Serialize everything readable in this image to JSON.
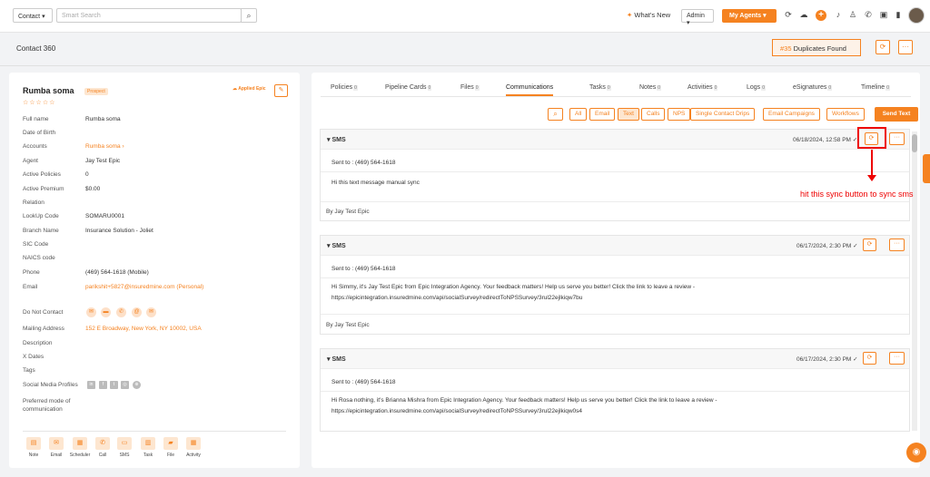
{
  "topbar": {
    "module_select": "Contact",
    "search_placeholder": "Smart Search",
    "whats_new": "What's New",
    "admin": "Admin",
    "my_agents": "My Agents"
  },
  "header": {
    "title": "Contact 360",
    "duplicates_count": "#35",
    "duplicates_label": "Duplicates Found"
  },
  "contact": {
    "name": "Rumba soma",
    "badge": "Prospect",
    "applied_epic": "Applied Epic",
    "fields": [
      {
        "label": "Full name",
        "value": "Rumba soma"
      },
      {
        "label": "Date of Birth",
        "value": ""
      },
      {
        "label": "Accounts",
        "value": "Rumba soma ›",
        "link": true
      },
      {
        "label": "Agent",
        "value": "Jay Test Epic"
      },
      {
        "label": "Active Policies",
        "value": "0"
      },
      {
        "label": "Active Premium",
        "value": "$0.00"
      },
      {
        "label": "Relation",
        "value": ""
      },
      {
        "label": "LookUp Code",
        "value": "SOMARU0001"
      },
      {
        "label": "Branch Name",
        "value": "Insurance Solution - Joliet"
      },
      {
        "label": "SIC Code",
        "value": ""
      },
      {
        "label": "NAICS code",
        "value": ""
      },
      {
        "label": "Phone",
        "value": "(469) 564-1618 (Mobile)"
      },
      {
        "label": "Email",
        "value": "parikshit+5827@insuredmine.com  (Personal)",
        "link": true
      }
    ],
    "do_not_contact": "Do Not Contact",
    "mailing_label": "Mailing Address",
    "mailing_value": "152 E Broadway, New York, NY 10002, USA",
    "description": "Description",
    "x_dates": "X Dates",
    "tags": "Tags",
    "social": "Social Media Profiles",
    "preferred_1": "Preferred mode of",
    "preferred_2": "communication",
    "actions": [
      "Note",
      "Email",
      "Scheduler",
      "Call",
      "SMS",
      "Task",
      "File",
      "Activity"
    ]
  },
  "tabs": [
    {
      "label": "Policies",
      "count": "0"
    },
    {
      "label": "Pipeline Cards",
      "count": "0"
    },
    {
      "label": "Files",
      "count": "0"
    },
    {
      "label": "Communications",
      "count": ""
    },
    {
      "label": "Tasks",
      "count": "0"
    },
    {
      "label": "Notes",
      "count": "0"
    },
    {
      "label": "Activities",
      "count": "0"
    },
    {
      "label": "Logs",
      "count": "0"
    },
    {
      "label": "eSignatures",
      "count": "0"
    },
    {
      "label": "Timeline",
      "count": "0"
    }
  ],
  "filters": [
    "All",
    "Email",
    "Text",
    "Calls",
    "NPS",
    "Single Contact Drips",
    "Email Campaigns",
    "Workflows"
  ],
  "send_text": "Send Text",
  "messages": [
    {
      "type": "SMS",
      "date": "06/18/2024, 12:58 PM",
      "sent_to": "Sent to : (469) 564-1618",
      "body": "Hi this text message manual sync",
      "by": "By Jay Test Epic"
    },
    {
      "type": "SMS",
      "date": "06/17/2024, 2:30 PM",
      "sent_to": "Sent to : (469) 564-1618",
      "body": "Hi Simmy, it's Jay Test Epic from Epic Integration Agency. Your feedback matters! Help us serve you better! Click the link to leave a review - https://epicintegration.insuredmine.com/api/socialSurvey/redirectToNPSSurvey/3rul22ejlkiqw7bu",
      "by": "By Jay Test Epic"
    },
    {
      "type": "SMS",
      "date": "06/17/2024, 2:30 PM",
      "sent_to": "Sent to : (469) 564-1618",
      "body": "Hi Rosa nothing, it's Brianna Mishra from Epic Integration Agency. Your feedback matters! Help us serve you better! Click the link to leave a review - https://epicintegration.insuredmine.com/api/socialSurvey/redirectToNPSSurvey/3rul22ejlkiqw0s4",
      "by": ""
    }
  ],
  "annotation": "hit this sync button to sync sms"
}
